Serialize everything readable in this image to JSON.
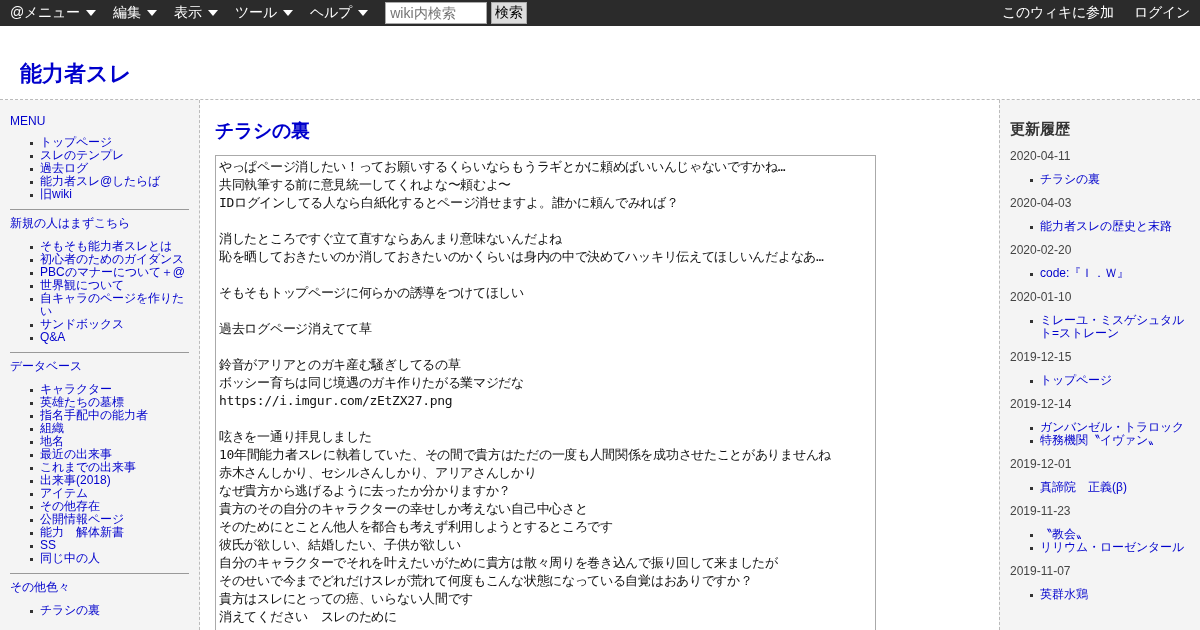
{
  "top_bar": {
    "menus": [
      {
        "label": "@メニュー"
      },
      {
        "label": "編集"
      },
      {
        "label": "表示"
      },
      {
        "label": "ツール"
      },
      {
        "label": "ヘルプ"
      }
    ],
    "search": {
      "placeholder": "wiki内検索"
    },
    "search_button": "検索",
    "links": [
      "このウィキに参加",
      "ログイン"
    ]
  },
  "site_title": "能力者スレ",
  "left_sidebar": {
    "sections": [
      {
        "heading": "MENU",
        "items": [
          "トップページ",
          "スレのテンプレ",
          "過去ログ",
          "能力者スレ@したらば",
          "旧wiki"
        ]
      },
      {
        "heading": "新規の人はまずこちら",
        "items": [
          "そもそも能力者スレとは",
          "初心者のためのガイダンス",
          "PBCのマナーについて＋@",
          "世界観について",
          "自キャラのページを作りたい",
          "サンドボックス",
          "Q&A"
        ]
      },
      {
        "heading": "データベース",
        "items": [
          "キャラクター",
          "英雄たちの墓標",
          "指名手配中の能力者",
          "組織",
          "地名",
          "最近の出来事",
          "これまでの出来事",
          "出来事(2018)",
          "アイテム",
          "その他存在",
          "公開情報ページ",
          "能力　解体新書",
          "SS",
          "同じ中の人"
        ]
      },
      {
        "heading": "その他色々",
        "items": [
          "チラシの裏"
        ]
      }
    ]
  },
  "page_title": "チラシの裏",
  "text_area": {
    "paragraphs": [
      [
        "やっぱページ消したい！ってお願いするくらいならもうラギとかに頼めばいいんじゃないですかね…",
        "共同執筆する前に意見統一してくれよな〜頼むよ〜",
        "IDログインしてる人なら白紙化するとページ消せますよ。誰かに頼んでみれば？"
      ],
      [
        "消したところですぐ立て直すならあんまり意味ないんだよね",
        "恥を晒しておきたいのか消しておきたいのかくらいは身内の中で決めてハッキリ伝えてほしいんだよなあ…"
      ],
      [
        "そもそもトップページに何らかの誘導をつけてほしい"
      ],
      [
        "過去ログページ消えてて草"
      ],
      [
        "鈴音がアリアとのガキ産む騒ぎしてるの草",
        "ボッシー育ちは同じ境遇のガキ作りたがる業マジだな",
        "https://i.imgur.com/zEtZX27.png"
      ],
      [
        "呟きを一通り拝見しました",
        "10年間能力者スレに執着していた、その間で貴方はただの一度も人間関係を成功させたことがありませんね",
        "赤木さんしかり、セシルさんしかり、アリアさんしかり",
        "なぜ貴方から逃げるように去ったか分かりますか？",
        "貴方のその自分のキャラクターの幸せしか考えない自己中心さと",
        "そのためにとことん他人を都合も考えず利用しようとするところです",
        "彼氏が欲しい、結婚したい、子供が欲しい",
        "自分のキャラクターでそれを叶えたいがために貴方は散々周りを巻き込んで振り回して来ましたが",
        "そのせいで今までどれだけスレが荒れて何度もこんな状態になっている自覚はおありですか？",
        "貴方はスレにとっての癌、いらない人間です",
        "消えてください　スレのために"
      ]
    ]
  },
  "right_sidebar": {
    "title": "更新履歴",
    "entries": [
      {
        "date": "2020-04-11",
        "items": [
          "チラシの裏"
        ]
      },
      {
        "date": "2020-04-03",
        "items": [
          "能力者スレの歴史と末路"
        ]
      },
      {
        "date": "2020-02-20",
        "items": [
          "code:『Ｉ．Ｗ』"
        ]
      },
      {
        "date": "2020-01-10",
        "items": [
          "ミレーユ・ミスゲシュタルト=ストレーン"
        ]
      },
      {
        "date": "2019-12-15",
        "items": [
          "トップページ"
        ]
      },
      {
        "date": "2019-12-14",
        "items": [
          "ガンバンゼル・トラロック",
          "特務機関〝イヴァン〟"
        ]
      },
      {
        "date": "2019-12-01",
        "items": [
          "真諦院　正義(β)"
        ]
      },
      {
        "date": "2019-11-23",
        "items": [
          "〝教会〟",
          "リリウム・ローゼンタール"
        ]
      },
      {
        "date": "2019-11-07",
        "items": [
          "英群水鶏"
        ]
      }
    ]
  }
}
